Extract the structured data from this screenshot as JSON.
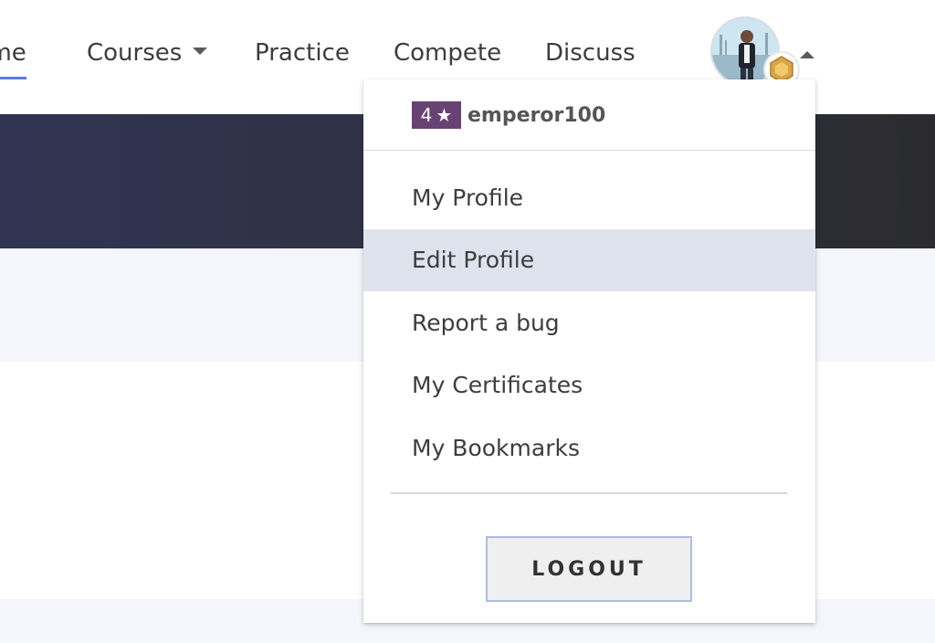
{
  "nav": {
    "items": [
      {
        "label": "Home"
      },
      {
        "label": "Courses"
      },
      {
        "label": "Practice"
      },
      {
        "label": "Compete"
      },
      {
        "label": "Discuss"
      }
    ]
  },
  "user": {
    "rating_stars": "4",
    "star_glyph": "★",
    "username": "emperor100"
  },
  "dropdown": {
    "items": [
      {
        "label": "My Profile"
      },
      {
        "label": "Edit Profile"
      },
      {
        "label": "Report a bug"
      },
      {
        "label": "My Certificates"
      },
      {
        "label": "My Bookmarks"
      }
    ],
    "logout_label": "LOGOUT"
  },
  "colors": {
    "accent": "#5a7bd8",
    "rating_badge": "#684273",
    "hero": "#2f3140",
    "hover_item": "#dfe3ee"
  },
  "icons": [
    "courses-chevron-down-icon",
    "avatar",
    "badge-icon",
    "avatar-chevron-up-icon",
    "star-icon"
  ]
}
